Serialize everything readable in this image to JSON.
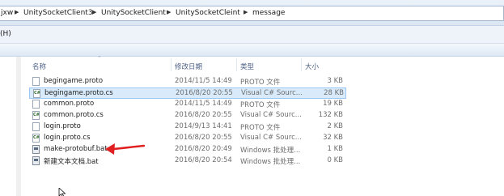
{
  "address_bar": {
    "path": [
      "jxw",
      "UnitySocketClient3",
      "UnitySocketClient",
      "UnitySocketCleint",
      "message"
    ]
  },
  "menu": {
    "partial_item": "(H)"
  },
  "columns": {
    "name": "名称",
    "modified": "修改日期",
    "type": "类型",
    "size": "大小"
  },
  "files": [
    {
      "name": "begingame.proto",
      "modified": "2014/11/5 14:49",
      "type": "PROTO 文件",
      "size": "3 KB",
      "icon": "proto-file-icon",
      "selected": false
    },
    {
      "name": "begingame.proto.cs",
      "modified": "2016/8/20 20:55",
      "type": "Visual C# Sourc...",
      "size": "28 KB",
      "icon": "csharp-file-icon",
      "selected": true
    },
    {
      "name": "common.proto",
      "modified": "2014/11/5 14:49",
      "type": "PROTO 文件",
      "size": "19 KB",
      "icon": "proto-file-icon",
      "selected": false
    },
    {
      "name": "common.proto.cs",
      "modified": "2016/8/20 20:55",
      "type": "Visual C# Sourc...",
      "size": "132 KB",
      "icon": "csharp-file-icon",
      "selected": false
    },
    {
      "name": "login.proto",
      "modified": "2014/9/13 14:41",
      "type": "PROTO 文件",
      "size": "2 KB",
      "icon": "proto-file-icon",
      "selected": false
    },
    {
      "name": "login.proto.cs",
      "modified": "2016/8/20 20:55",
      "type": "Visual C# Sourc...",
      "size": "32 KB",
      "icon": "csharp-file-icon",
      "selected": false
    },
    {
      "name": "make-protobuf.bat",
      "modified": "2016/8/20 20:49",
      "type": "Windows 批处理...",
      "size": "1 KB",
      "icon": "batch-file-icon",
      "selected": false
    },
    {
      "name": "新建文本文档.bat",
      "modified": "2016/8/20 20:54",
      "type": "Windows 批处理...",
      "size": "0 KB",
      "icon": "batch-file-icon",
      "selected": false
    }
  ],
  "colors": {
    "selection_bg": "#d9ebfb",
    "selection_border": "#99c9f4",
    "annotation_arrow": "#e02020",
    "header_text": "#4d6185"
  }
}
